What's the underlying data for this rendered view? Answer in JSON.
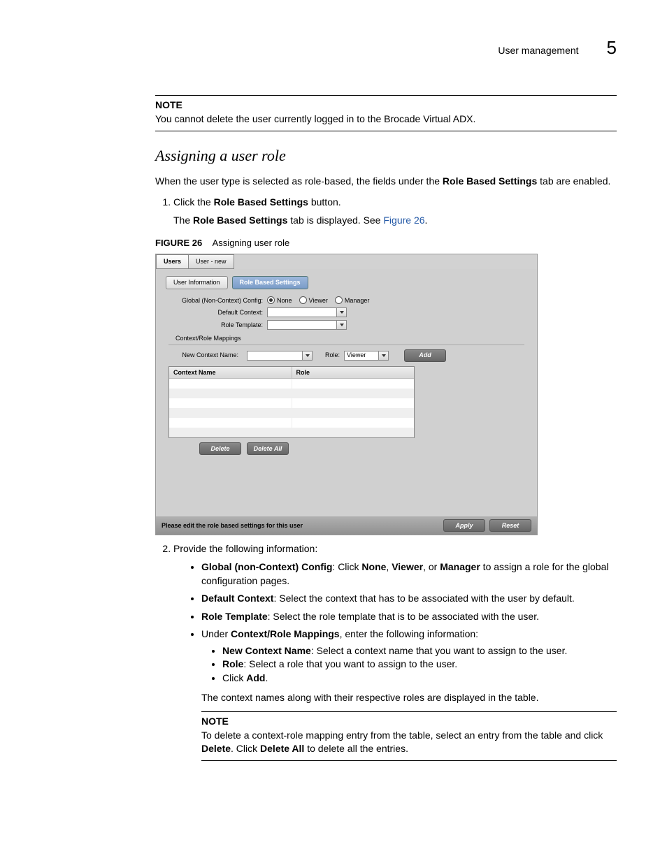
{
  "header": {
    "section": "User management",
    "pagenum": "5"
  },
  "note1": {
    "label": "NOTE",
    "text": "You cannot delete the user currently logged in to the Brocade Virtual ADX."
  },
  "heading": "Assigning a user role",
  "intro_before_bold": "When the user type is selected as role-based, the fields under the ",
  "intro_bold": "Role Based Settings",
  "intro_after_bold": " tab are enabled.",
  "step1": {
    "prefix": "Click the ",
    "bold": "Role Based Settings",
    "suffix": " button.",
    "line2_a": "The ",
    "line2_bold": "Role Based Settings",
    "line2_b": " tab is displayed. See ",
    "line2_link": "Figure 26",
    "line2_c": "."
  },
  "figure": {
    "label": "FIGURE 26",
    "caption": "Assigning user role"
  },
  "screenshot": {
    "tabs": {
      "users": "Users",
      "user_new": "User - new"
    },
    "subtabs": {
      "info": "User Information",
      "role": "Role Based Settings"
    },
    "labels": {
      "global": "Global (Non-Context) Config:",
      "default_ctx": "Default Context:",
      "role_tmpl": "Role Template:",
      "ctx_role_mappings": "Context/Role Mappings",
      "new_ctx_name": "New Context Name:",
      "role": "Role:"
    },
    "radios": {
      "none": "None",
      "viewer": "Viewer",
      "manager": "Manager"
    },
    "role_select_value": "Viewer",
    "buttons": {
      "add": "Add",
      "delete": "Delete",
      "delete_all": "Delete All",
      "apply": "Apply",
      "reset": "Reset"
    },
    "table": {
      "col1": "Context Name",
      "col2": "Role"
    },
    "status_text": "Please edit the role based settings for this user"
  },
  "step2": {
    "lead": "Provide the following information:",
    "b1_bold": "Global (non-Context) Config",
    "b1_a": ": Click ",
    "b1_opts_none": "None",
    "b1_sep1": ", ",
    "b1_opts_viewer": "Viewer",
    "b1_sep2": ", or ",
    "b1_opts_manager": "Manager",
    "b1_tail": " to assign a role for the global configuration pages.",
    "b2_bold": "Default Context",
    "b2_text": ": Select the context that has to be associated with the user by default.",
    "b3_bold": "Role Template",
    "b3_text": ": Select the role template that is to be associated with the user.",
    "b4_a": "Under ",
    "b4_bold": "Context/Role Mappings",
    "b4_b": ", enter the following information:",
    "b4s1_bold": "New Context Name",
    "b4s1_text": ": Select a context name that you want to assign to the user.",
    "b4s2_bold": "Role",
    "b4s2_text": ": Select a role that you want to assign to the user.",
    "b4s3_a": "Click ",
    "b4s3_bold": "Add",
    "b4s3_b": ".",
    "b4_tail": "The context names along with their respective roles are displayed in the table."
  },
  "note2": {
    "label": "NOTE",
    "a": "To delete a context-role mapping entry from the table, select an entry from the table and click ",
    "bold1": "Delete",
    "b": ". Click ",
    "bold2": "Delete All",
    "c": " to delete all the entries."
  }
}
